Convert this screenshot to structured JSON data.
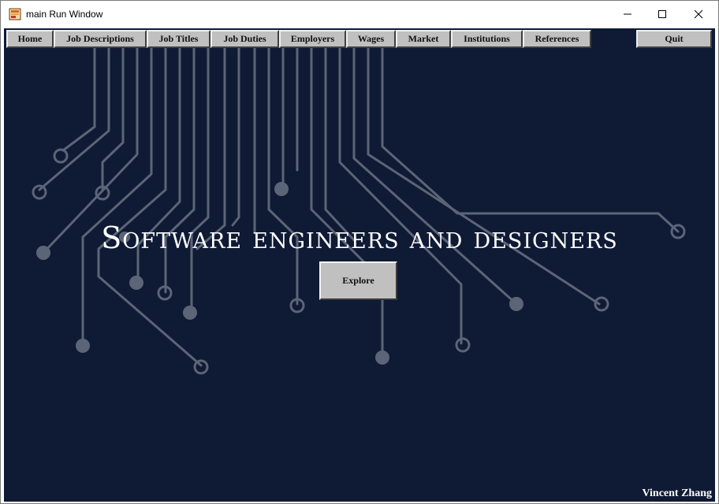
{
  "window": {
    "title": "main Run Window"
  },
  "menu": {
    "items": [
      {
        "label": "Home"
      },
      {
        "label": "Job Descriptions"
      },
      {
        "label": "Job Titles"
      },
      {
        "label": "Job Duties"
      },
      {
        "label": "Employers"
      },
      {
        "label": "Wages"
      },
      {
        "label": "Market"
      },
      {
        "label": "Institutions"
      },
      {
        "label": "References"
      }
    ],
    "quit_label": "Quit"
  },
  "hero": {
    "headline": "Software engineers and designers",
    "explore_label": "Explore"
  },
  "footer": {
    "author": "Vincent Zhang"
  },
  "colors": {
    "background": "#0f1a35",
    "circuit": "#5b6577",
    "button": "#c0c0c0",
    "text": "#ffffff"
  }
}
